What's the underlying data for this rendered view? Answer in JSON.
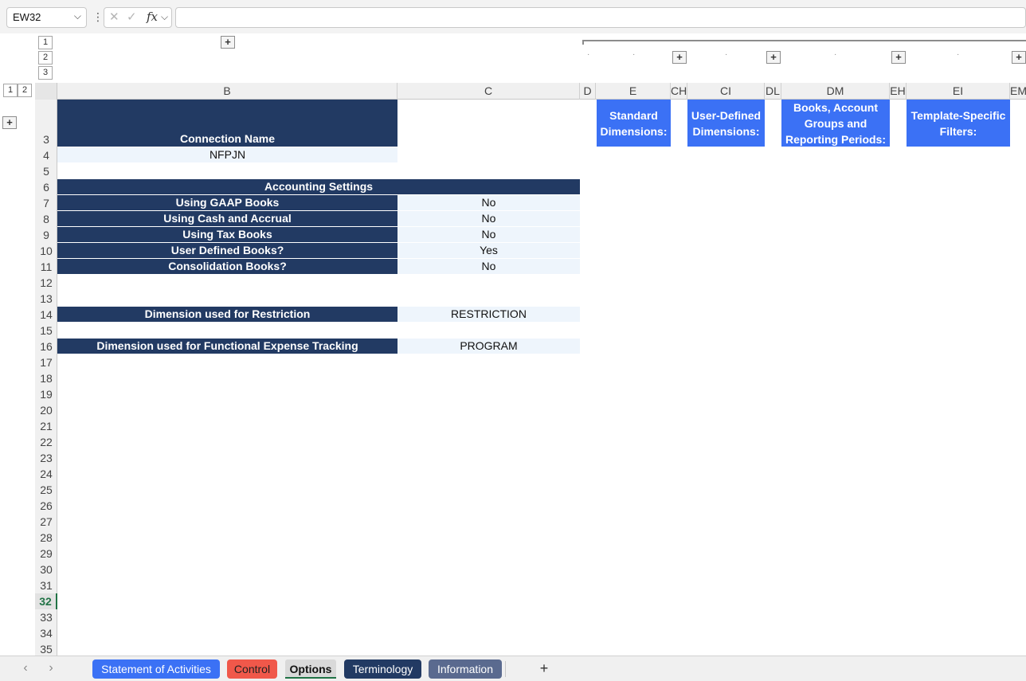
{
  "formula_bar": {
    "cell_ref": "EW32",
    "name_box_chevron": "⌵",
    "more": "⋮",
    "cancel_icon": "✕",
    "enter_icon": "✓",
    "fx_label": "fx",
    "fx_chevron": "⌵",
    "formula": ""
  },
  "outline": {
    "row_levels": [
      "1",
      "2"
    ],
    "col_levels": [
      "1",
      "2",
      "3"
    ],
    "expand": "+",
    "dot": "·"
  },
  "columns": [
    "B",
    "C",
    "D",
    "E",
    "CH",
    "CI",
    "DL",
    "DM",
    "EH",
    "EI",
    "EM"
  ],
  "rows": [
    "3",
    "4",
    "5",
    "6",
    "7",
    "8",
    "9",
    "10",
    "11",
    "12",
    "13",
    "14",
    "15",
    "16",
    "17",
    "18",
    "19",
    "20",
    "21",
    "22",
    "23",
    "24",
    "25",
    "26",
    "27",
    "28",
    "29",
    "30",
    "31",
    "32",
    "33",
    "34",
    "35"
  ],
  "active_row": "32",
  "sheet": {
    "connection_name_label": "Connection Name",
    "connection_name_value": "NFPJN",
    "accounting_header": "Accounting Settings",
    "settings": [
      {
        "label": "Using GAAP Books",
        "value": "No"
      },
      {
        "label": "Using Cash and Accrual",
        "value": "No"
      },
      {
        "label": "Using Tax Books",
        "value": "No"
      },
      {
        "label": "User Defined Books?",
        "value": "Yes"
      },
      {
        "label": "Consolidation Books?",
        "value": "No"
      }
    ],
    "restriction_label": "Dimension used for Restriction",
    "restriction_value": "RESTRICTION",
    "functional_label": "Dimension used for Functional Expense Tracking",
    "functional_value": "PROGRAM",
    "headers": {
      "standard": "Standard Dimensions:",
      "user_defined": "User-Defined Dimensions:",
      "books": "Books, Account Groups and Reporting Periods:",
      "template": "Template-Specific Filters:"
    }
  },
  "tabs_bar": {
    "prev": "‹",
    "next": "›",
    "add": "+",
    "tabs": [
      {
        "label": "Statement of Activities",
        "color": "#3b71f5"
      },
      {
        "label": "Control",
        "color": "#f0584a"
      },
      {
        "label": "Options",
        "color": "#d9d9d9"
      },
      {
        "label": "Terminology",
        "color": "#223a63"
      },
      {
        "label": "Information",
        "color": "#5a6a8f"
      }
    ]
  },
  "colors": {
    "navy": "#223a63",
    "light_fill": "#eef5fc",
    "accent_blue": "#3b71f5",
    "active_green": "#217346"
  }
}
